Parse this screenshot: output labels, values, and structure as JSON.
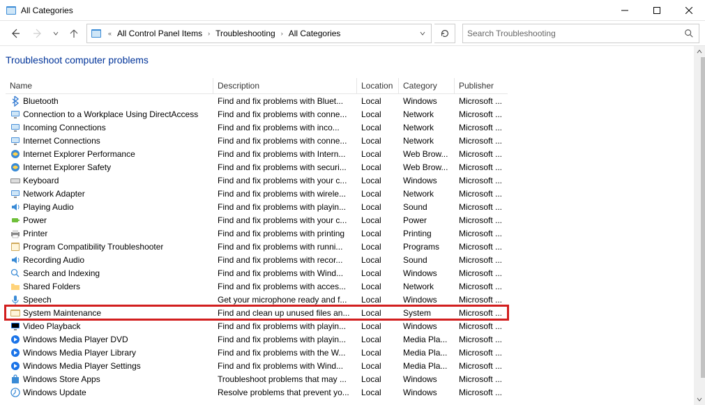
{
  "window": {
    "title": "All Categories"
  },
  "breadcrumbs": {
    "item0": "All Control Panel Items",
    "item1": "Troubleshooting",
    "item2": "All Categories"
  },
  "search": {
    "placeholder": "Search Troubleshooting"
  },
  "heading": "Troubleshoot computer problems",
  "columns": {
    "name": "Name",
    "description": "Description",
    "location": "Location",
    "category": "Category",
    "publisher": "Publisher"
  },
  "rows": [
    {
      "icon": "bluetooth-icon",
      "name": "Bluetooth",
      "desc": "Find and fix problems with Bluet...",
      "loc": "Local",
      "cat": "Windows",
      "pub": "Microsoft ..."
    },
    {
      "icon": "network-icon",
      "name": "Connection to a Workplace Using DirectAccess",
      "desc": "Find and fix problems with conne...",
      "loc": "Local",
      "cat": "Network",
      "pub": "Microsoft ..."
    },
    {
      "icon": "network-icon",
      "name": "Incoming Connections",
      "desc": "Find and fix problems with inco...",
      "loc": "Local",
      "cat": "Network",
      "pub": "Microsoft ..."
    },
    {
      "icon": "network-icon",
      "name": "Internet Connections",
      "desc": "Find and fix problems with conne...",
      "loc": "Local",
      "cat": "Network",
      "pub": "Microsoft ..."
    },
    {
      "icon": "ie-icon",
      "name": "Internet Explorer Performance",
      "desc": "Find and fix problems with Intern...",
      "loc": "Local",
      "cat": "Web Brow...",
      "pub": "Microsoft ..."
    },
    {
      "icon": "ie-icon",
      "name": "Internet Explorer Safety",
      "desc": "Find and fix problems with securi...",
      "loc": "Local",
      "cat": "Web Brow...",
      "pub": "Microsoft ..."
    },
    {
      "icon": "keyboard-icon",
      "name": "Keyboard",
      "desc": "Find and fix problems with your c...",
      "loc": "Local",
      "cat": "Windows",
      "pub": "Microsoft ..."
    },
    {
      "icon": "network-icon",
      "name": "Network Adapter",
      "desc": "Find and fix problems with wirele...",
      "loc": "Local",
      "cat": "Network",
      "pub": "Microsoft ..."
    },
    {
      "icon": "audio-icon",
      "name": "Playing Audio",
      "desc": "Find and fix problems with playin...",
      "loc": "Local",
      "cat": "Sound",
      "pub": "Microsoft ..."
    },
    {
      "icon": "power-icon",
      "name": "Power",
      "desc": "Find and fix problems with your c...",
      "loc": "Local",
      "cat": "Power",
      "pub": "Microsoft ..."
    },
    {
      "icon": "printer-icon",
      "name": "Printer",
      "desc": "Find and fix problems with printing",
      "loc": "Local",
      "cat": "Printing",
      "pub": "Microsoft ..."
    },
    {
      "icon": "program-icon",
      "name": "Program Compatibility Troubleshooter",
      "desc": "Find and fix problems with runni...",
      "loc": "Local",
      "cat": "Programs",
      "pub": "Microsoft ..."
    },
    {
      "icon": "audio-icon",
      "name": "Recording Audio",
      "desc": "Find and fix problems with recor...",
      "loc": "Local",
      "cat": "Sound",
      "pub": "Microsoft ..."
    },
    {
      "icon": "search-icon",
      "name": "Search and Indexing",
      "desc": "Find and fix problems with Wind...",
      "loc": "Local",
      "cat": "Windows",
      "pub": "Microsoft ..."
    },
    {
      "icon": "folder-icon",
      "name": "Shared Folders",
      "desc": "Find and fix problems with acces...",
      "loc": "Local",
      "cat": "Network",
      "pub": "Microsoft ..."
    },
    {
      "icon": "mic-icon",
      "name": "Speech",
      "desc": "Get your microphone ready and f...",
      "loc": "Local",
      "cat": "Windows",
      "pub": "Microsoft ..."
    },
    {
      "icon": "system-icon",
      "name": "System Maintenance",
      "desc": "Find and clean up unused files an...",
      "loc": "Local",
      "cat": "System",
      "pub": "Microsoft ...",
      "highlight": true
    },
    {
      "icon": "video-icon",
      "name": "Video Playback",
      "desc": "Find and fix problems with playin...",
      "loc": "Local",
      "cat": "Windows",
      "pub": "Microsoft ..."
    },
    {
      "icon": "wmp-icon",
      "name": "Windows Media Player DVD",
      "desc": "Find and fix problems with playin...",
      "loc": "Local",
      "cat": "Media Pla...",
      "pub": "Microsoft ..."
    },
    {
      "icon": "wmp-icon",
      "name": "Windows Media Player Library",
      "desc": "Find and fix problems with the W...",
      "loc": "Local",
      "cat": "Media Pla...",
      "pub": "Microsoft ..."
    },
    {
      "icon": "wmp-icon",
      "name": "Windows Media Player Settings",
      "desc": "Find and fix problems with Wind...",
      "loc": "Local",
      "cat": "Media Pla...",
      "pub": "Microsoft ..."
    },
    {
      "icon": "store-icon",
      "name": "Windows Store Apps",
      "desc": "Troubleshoot problems that may ...",
      "loc": "Local",
      "cat": "Windows",
      "pub": "Microsoft ..."
    },
    {
      "icon": "update-icon",
      "name": "Windows Update",
      "desc": "Resolve problems that prevent yo...",
      "loc": "Local",
      "cat": "Windows",
      "pub": "Microsoft ..."
    }
  ]
}
